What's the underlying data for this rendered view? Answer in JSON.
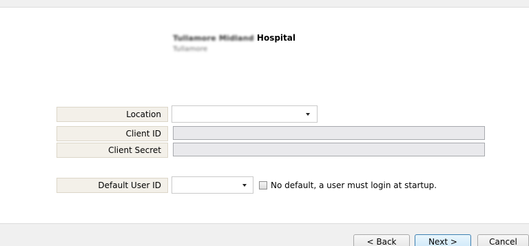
{
  "header": {
    "org_name_blurred": "Tullamore Midland",
    "org_name_visible": "Hospital",
    "org_subtitle_blurred": "Tullamore"
  },
  "form": {
    "location_label": "Location",
    "location_value": "",
    "client_id_label": "Client ID",
    "client_id_value": "",
    "client_secret_label": "Client Secret",
    "client_secret_value": "",
    "default_user_label": "Default User ID",
    "default_user_value": "",
    "no_default_checkbox_label": "No default, a user must login at startup.",
    "no_default_checked": false
  },
  "footer": {
    "back_label": "< Back",
    "next_label": "Next >",
    "cancel_label": "Cancel"
  },
  "icons": {
    "dropdown": "chevron-down-icon",
    "checkbox": "checkbox-icon"
  }
}
